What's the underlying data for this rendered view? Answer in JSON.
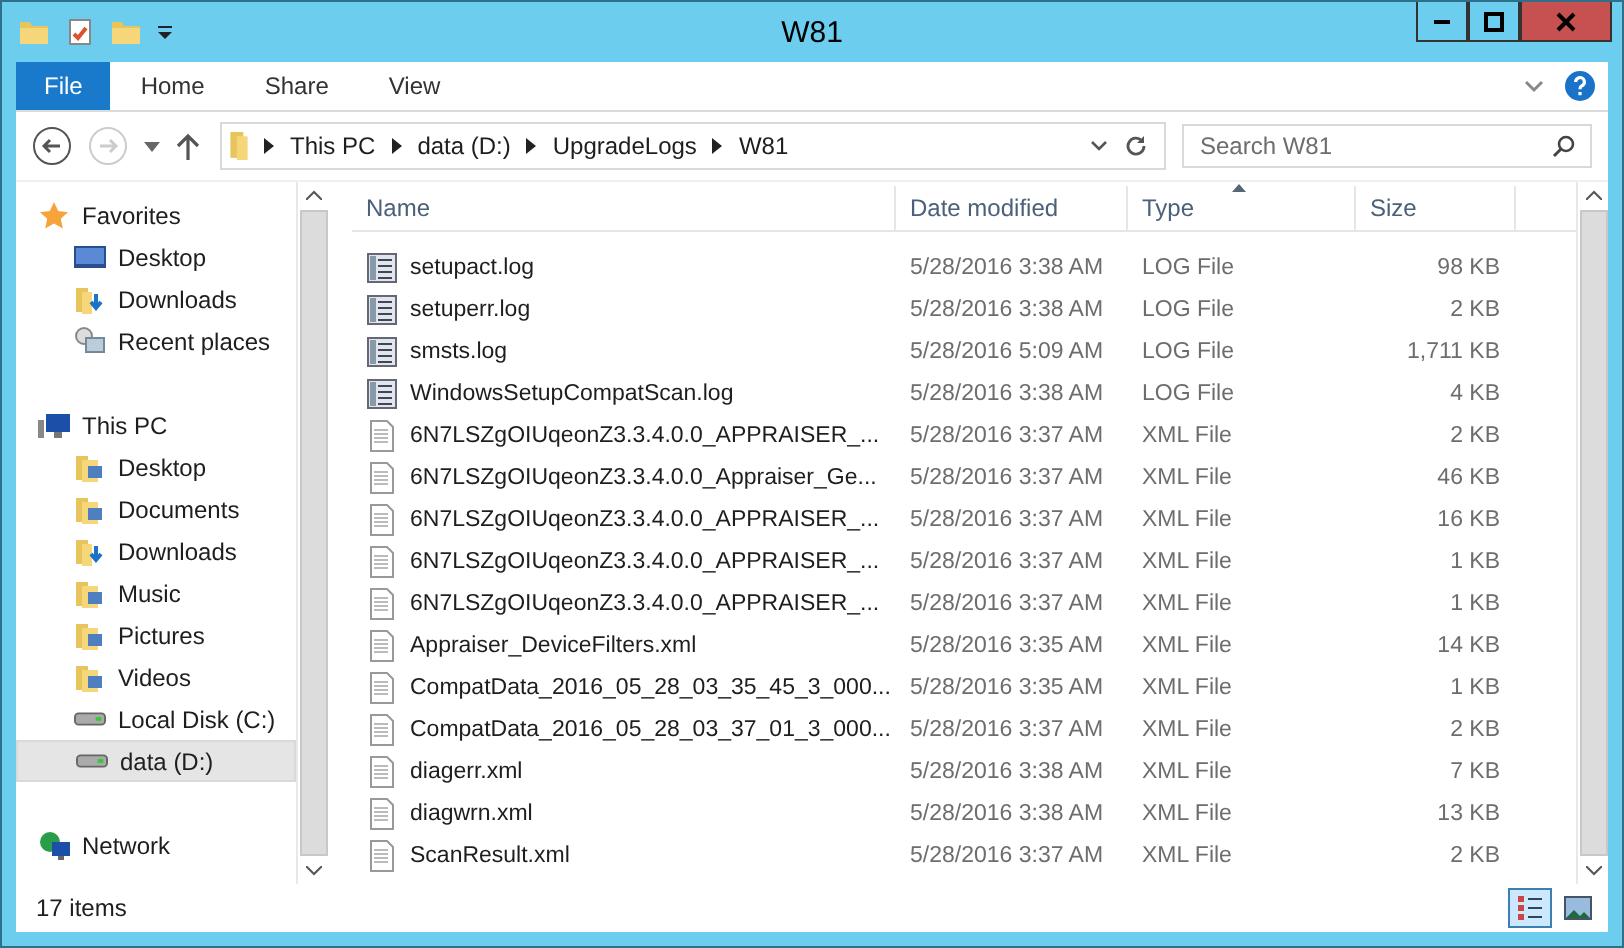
{
  "window": {
    "title": "W81"
  },
  "ribbon": {
    "tabs": [
      {
        "label": "File",
        "selected": true
      },
      {
        "label": "Home",
        "selected": false
      },
      {
        "label": "Share",
        "selected": false
      },
      {
        "label": "View",
        "selected": false
      }
    ]
  },
  "address": {
    "breadcrumbs": [
      "This PC",
      "data (D:)",
      "UpgradeLogs",
      "W81"
    ]
  },
  "search": {
    "placeholder": "Search W81"
  },
  "nav_tree": [
    {
      "label": "Favorites",
      "kind": "star",
      "selected": false,
      "children": [
        {
          "label": "Desktop",
          "kind": "desktop",
          "selected": false
        },
        {
          "label": "Downloads",
          "kind": "folder-download",
          "selected": false
        },
        {
          "label": "Recent places",
          "kind": "recent",
          "selected": false
        }
      ]
    },
    {
      "label": "This PC",
      "kind": "pc",
      "selected": false,
      "children": [
        {
          "label": "Desktop",
          "kind": "folder",
          "selected": false
        },
        {
          "label": "Documents",
          "kind": "folder",
          "selected": false
        },
        {
          "label": "Downloads",
          "kind": "folder-download",
          "selected": false
        },
        {
          "label": "Music",
          "kind": "folder",
          "selected": false
        },
        {
          "label": "Pictures",
          "kind": "folder",
          "selected": false
        },
        {
          "label": "Videos",
          "kind": "folder",
          "selected": false
        },
        {
          "label": "Local Disk (C:)",
          "kind": "disk",
          "selected": false
        },
        {
          "label": "data (D:)",
          "kind": "disk",
          "selected": true
        }
      ]
    },
    {
      "label": "Network",
      "kind": "network",
      "selected": false
    }
  ],
  "table": {
    "columns": [
      {
        "label": "Name",
        "sorted": false
      },
      {
        "label": "Date modified",
        "sorted": false
      },
      {
        "label": "Type",
        "sorted": true
      },
      {
        "label": "Size",
        "sorted": false
      }
    ],
    "rows": [
      {
        "name": "setupact.log",
        "date": "5/28/2016 3:38 AM",
        "type": "LOG File",
        "size": "98 KB",
        "kind": "log"
      },
      {
        "name": "setuperr.log",
        "date": "5/28/2016 3:38 AM",
        "type": "LOG File",
        "size": "2 KB",
        "kind": "log"
      },
      {
        "name": "smsts.log",
        "date": "5/28/2016 5:09 AM",
        "type": "LOG File",
        "size": "1,711 KB",
        "kind": "log"
      },
      {
        "name": "WindowsSetupCompatScan.log",
        "date": "5/28/2016 3:38 AM",
        "type": "LOG File",
        "size": "4 KB",
        "kind": "log"
      },
      {
        "name": "6N7LSZgOIUqeonZ3.3.4.0.0_APPRAISER_...",
        "date": "5/28/2016 3:37 AM",
        "type": "XML File",
        "size": "2 KB",
        "kind": "xml"
      },
      {
        "name": "6N7LSZgOIUqeonZ3.3.4.0.0_Appraiser_Ge...",
        "date": "5/28/2016 3:37 AM",
        "type": "XML File",
        "size": "46 KB",
        "kind": "xml"
      },
      {
        "name": "6N7LSZgOIUqeonZ3.3.4.0.0_APPRAISER_...",
        "date": "5/28/2016 3:37 AM",
        "type": "XML File",
        "size": "16 KB",
        "kind": "xml"
      },
      {
        "name": "6N7LSZgOIUqeonZ3.3.4.0.0_APPRAISER_...",
        "date": "5/28/2016 3:37 AM",
        "type": "XML File",
        "size": "1 KB",
        "kind": "xml"
      },
      {
        "name": "6N7LSZgOIUqeonZ3.3.4.0.0_APPRAISER_...",
        "date": "5/28/2016 3:37 AM",
        "type": "XML File",
        "size": "1 KB",
        "kind": "xml"
      },
      {
        "name": "Appraiser_DeviceFilters.xml",
        "date": "5/28/2016 3:35 AM",
        "type": "XML File",
        "size": "14 KB",
        "kind": "xml"
      },
      {
        "name": "CompatData_2016_05_28_03_35_45_3_000...",
        "date": "5/28/2016 3:35 AM",
        "type": "XML File",
        "size": "1 KB",
        "kind": "xml"
      },
      {
        "name": "CompatData_2016_05_28_03_37_01_3_000...",
        "date": "5/28/2016 3:37 AM",
        "type": "XML File",
        "size": "2 KB",
        "kind": "xml"
      },
      {
        "name": "diagerr.xml",
        "date": "5/28/2016 3:38 AM",
        "type": "XML File",
        "size": "7 KB",
        "kind": "xml"
      },
      {
        "name": "diagwrn.xml",
        "date": "5/28/2016 3:38 AM",
        "type": "XML File",
        "size": "13 KB",
        "kind": "xml"
      },
      {
        "name": "ScanResult.xml",
        "date": "5/28/2016 3:37 AM",
        "type": "XML File",
        "size": "2 KB",
        "kind": "xml"
      }
    ]
  },
  "status_bar": {
    "count": "17 items"
  },
  "view_buttons": [
    {
      "kind": "details",
      "selected": true
    },
    {
      "kind": "large-icons",
      "selected": false
    }
  ]
}
